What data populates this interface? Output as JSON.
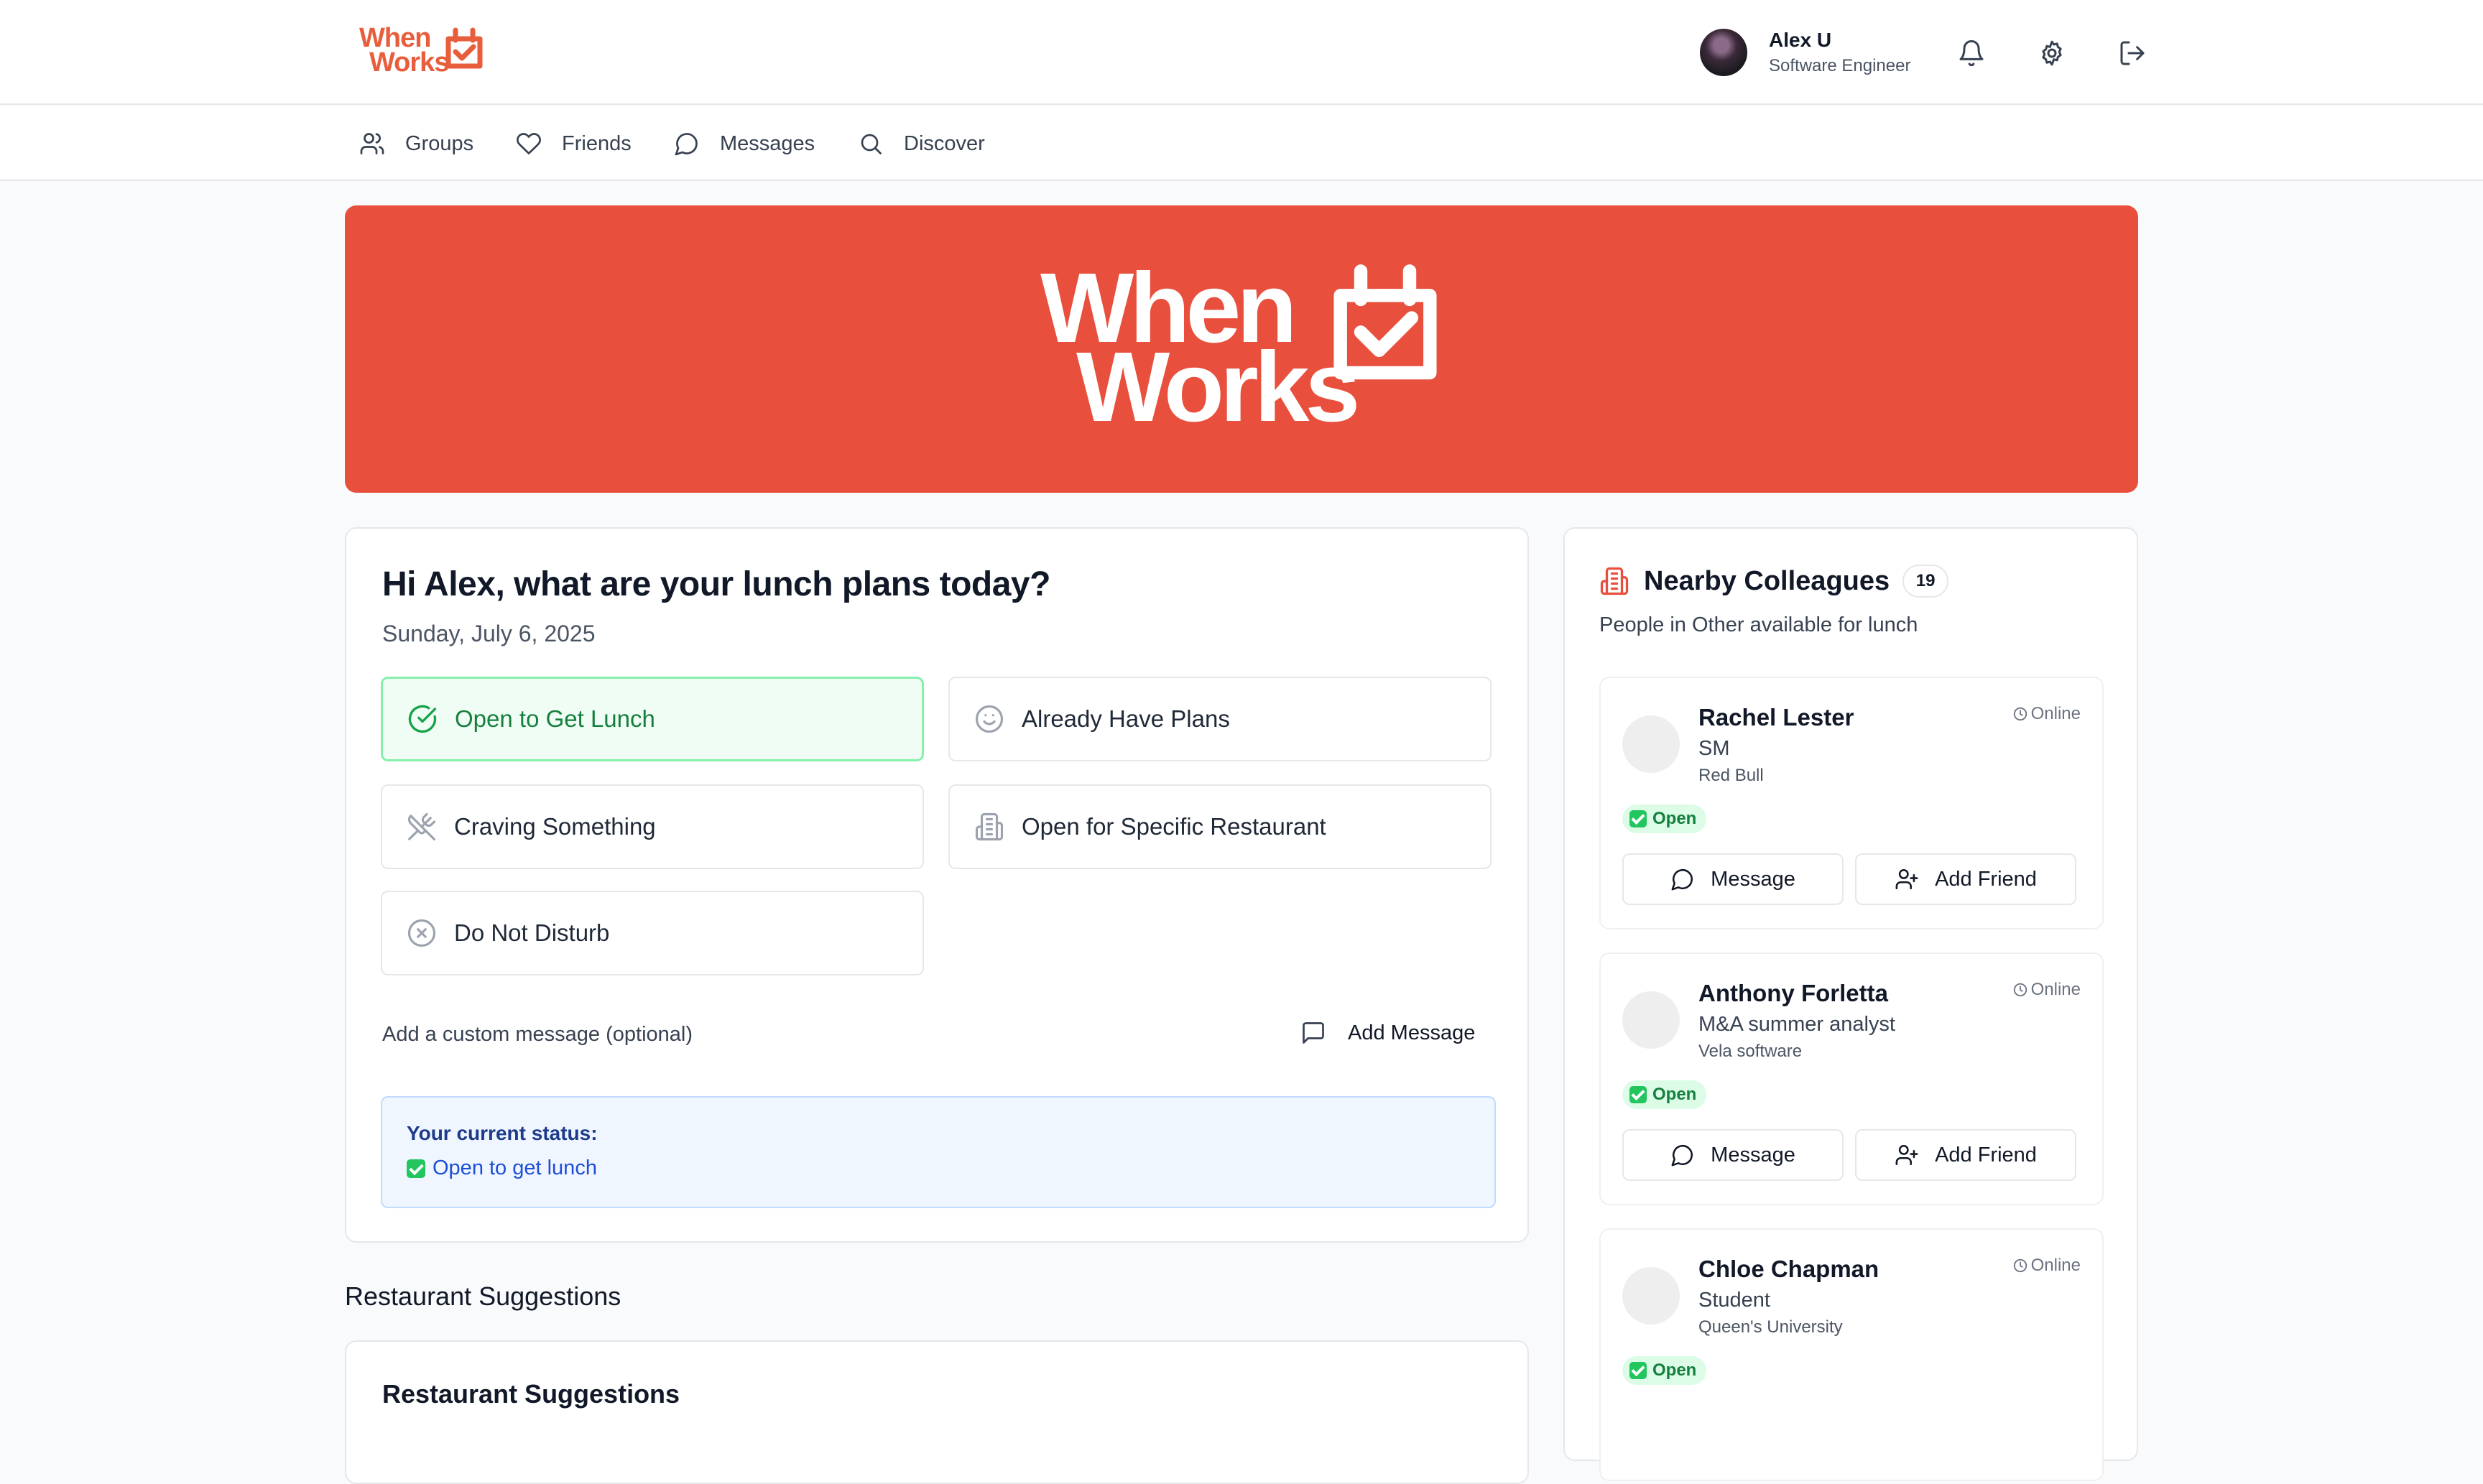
{
  "brand": {
    "line1": "When",
    "line2": "Works",
    "color": "#e94f3d"
  },
  "user": {
    "name": "Alex U",
    "title": "Software Engineer"
  },
  "header_icons": [
    "bell-icon",
    "gear-icon",
    "logout-icon"
  ],
  "nav": [
    {
      "label": "Groups",
      "icon": "users-icon"
    },
    {
      "label": "Friends",
      "icon": "heart-icon"
    },
    {
      "label": "Messages",
      "icon": "message-icon"
    },
    {
      "label": "Discover",
      "icon": "search-icon"
    }
  ],
  "status": {
    "greeting": "Hi Alex, what are your lunch plans today?",
    "date": "Sunday, July 6, 2025",
    "options": [
      {
        "label": "Open to Get Lunch",
        "icon": "check-circle-icon",
        "selected": true
      },
      {
        "label": "Already Have Plans",
        "icon": "smile-icon",
        "selected": false
      },
      {
        "label": "Craving Something",
        "icon": "utensils-crossed-icon",
        "selected": false
      },
      {
        "label": "Open for Specific Restaurant",
        "icon": "building-icon",
        "selected": false
      },
      {
        "label": "Do Not Disturb",
        "icon": "x-circle-icon",
        "selected": false
      }
    ],
    "custom_message_label": "Add a custom message (optional)",
    "add_message_label": "Add Message",
    "current_title": "Your current status:",
    "current_value": "Open to get lunch"
  },
  "suggestions": {
    "section_title": "Restaurant Suggestions",
    "card_title": "Restaurant Suggestions"
  },
  "colleagues": {
    "title": "Nearby Colleagues",
    "count": "19",
    "subtitle": "People in Other available for lunch",
    "message_label": "Message",
    "add_friend_label": "Add Friend",
    "online_label": "Online",
    "open_label": "Open",
    "people": [
      {
        "name": "Rachel Lester",
        "role": "SM",
        "org": "Red Bull"
      },
      {
        "name": "Anthony Forletta",
        "role": "M&A summer analyst",
        "org": "Vela software"
      },
      {
        "name": "Chloe Chapman",
        "role": "Student",
        "org": "Queen's University"
      }
    ]
  }
}
